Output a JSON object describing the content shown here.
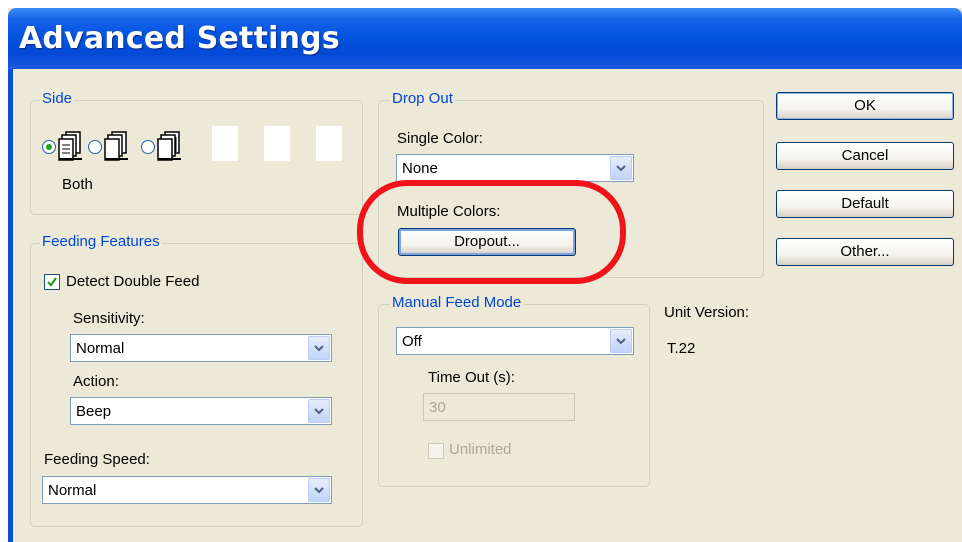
{
  "window": {
    "title": "Advanced Settings"
  },
  "side": {
    "legend": "Side",
    "selected_label": "Both",
    "options": [
      {
        "icon": "document-both-icon",
        "selected": true
      },
      {
        "icon": "document-front-icon",
        "selected": false
      },
      {
        "icon": "document-back-icon",
        "selected": false
      }
    ]
  },
  "feeding": {
    "legend": "Feeding Features",
    "detect_double_feed": {
      "label": "Detect Double Feed",
      "checked": true
    },
    "sensitivity": {
      "label": "Sensitivity:",
      "value": "Normal"
    },
    "action": {
      "label": "Action:",
      "value": "Beep"
    },
    "speed": {
      "label": "Feeding Speed:",
      "value": "Normal"
    }
  },
  "dropout": {
    "legend": "Drop Out",
    "single_color": {
      "label": "Single Color:",
      "value": "None"
    },
    "multiple_colors": {
      "label": "Multiple Colors:",
      "button_label": "Dropout..."
    }
  },
  "manual_feed": {
    "legend": "Manual Feed Mode",
    "mode": {
      "value": "Off"
    },
    "timeout": {
      "label": "Time Out (s):",
      "value": "30",
      "enabled": false
    },
    "unlimited": {
      "label": "Unlimited",
      "checked": false,
      "enabled": false
    }
  },
  "unit_version": {
    "label": "Unit Version:",
    "value": "T.22"
  },
  "buttons": {
    "ok": "OK",
    "cancel": "Cancel",
    "default": "Default",
    "other": "Other..."
  },
  "colors": {
    "title_bar": "#0454e2",
    "dialog_bg": "#ece9d8",
    "legend_text": "#0046d5",
    "highlight": "#f0141a",
    "radio_dot": "#21a121"
  }
}
